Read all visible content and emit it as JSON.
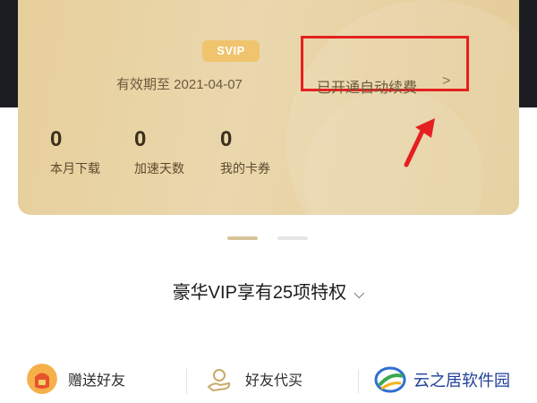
{
  "vip_card": {
    "badge": "SVIP",
    "validity_text": "有效期至 2021-04-07",
    "auto_renew_label": "已开通自动续费",
    "auto_renew_chevron": ">",
    "stats": [
      {
        "value": "0",
        "label": "本月下载"
      },
      {
        "value": "0",
        "label": "加速天数"
      },
      {
        "value": "0",
        "label": "我的卡券"
      }
    ]
  },
  "pager": {
    "active_index": 0,
    "count": 2
  },
  "privilege": {
    "title": "豪华VIP享有25项特权",
    "chevron": "⌵"
  },
  "actions": [
    {
      "label": "赠送好友",
      "icon": "gift-bag-icon"
    },
    {
      "label": "好友代买",
      "icon": "hand-coin-icon"
    }
  ],
  "watermark": {
    "text": "云之居软件园"
  },
  "colors": {
    "card_gold": "#e7cf9b",
    "badge_gold": "#f0c36d",
    "highlight_red": "#e52020",
    "watermark_blue": "#1f3f99"
  }
}
